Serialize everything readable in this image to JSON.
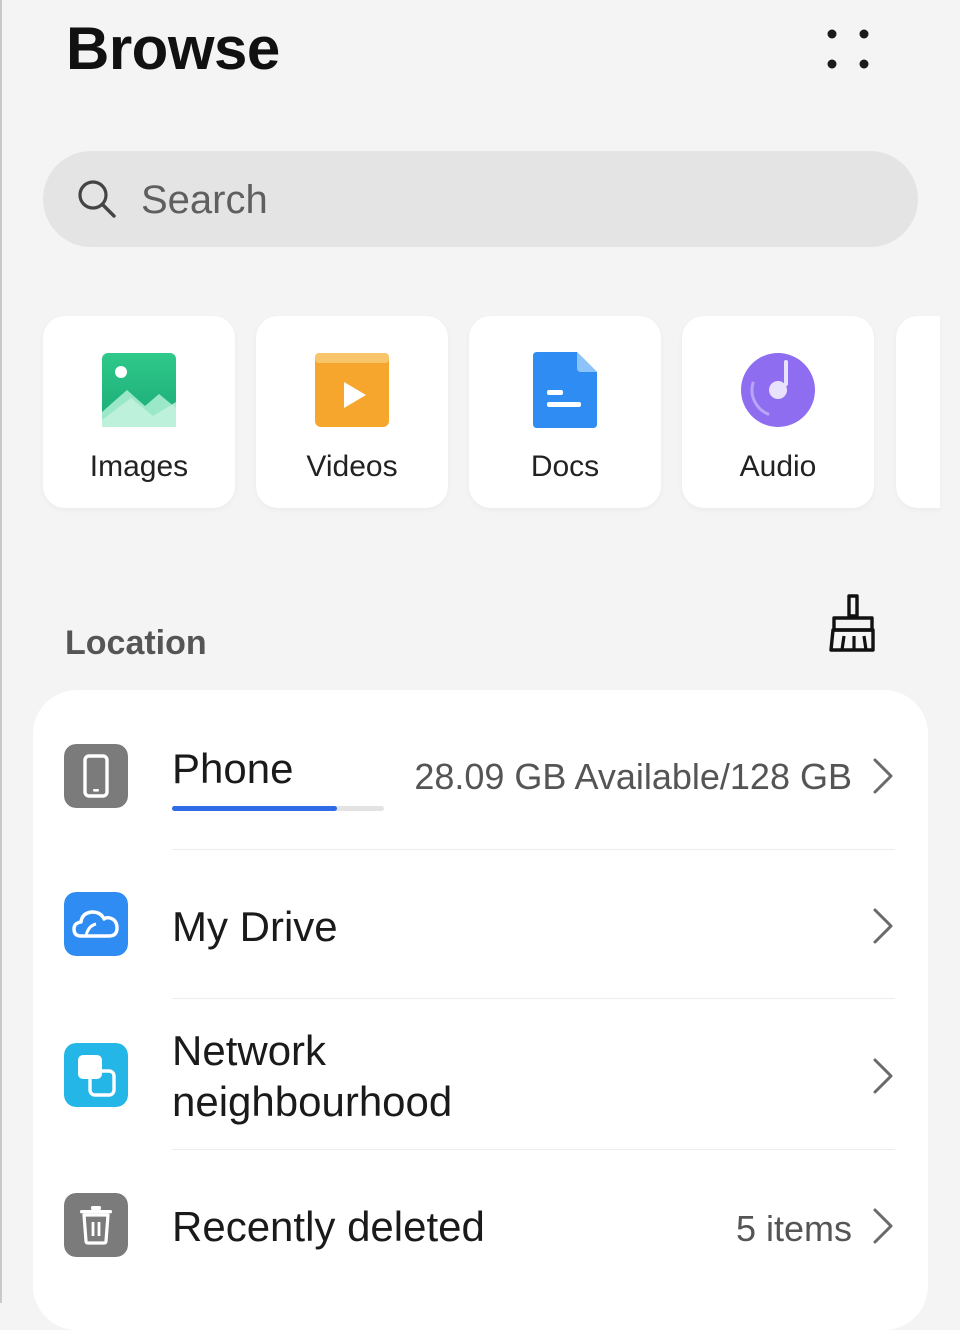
{
  "header": {
    "title": "Browse"
  },
  "search": {
    "placeholder": "Search"
  },
  "categories": [
    {
      "label": "Images",
      "icon": "image-icon"
    },
    {
      "label": "Videos",
      "icon": "video-icon"
    },
    {
      "label": "Docs",
      "icon": "document-icon"
    },
    {
      "label": "Audio",
      "icon": "audio-icon"
    }
  ],
  "location": {
    "title": "Location",
    "items": [
      {
        "label": "Phone",
        "value": "28.09 GB Available/128 GB",
        "icon": "phone-icon",
        "storage_used_fraction": 0.78
      },
      {
        "label": "My Drive",
        "value": "",
        "icon": "cloud-icon"
      },
      {
        "label_line1": "Network",
        "label_line2": "neighbourhood",
        "value": "",
        "icon": "network-icon"
      },
      {
        "label": "Recently deleted",
        "value": "5 items",
        "icon": "trash-icon"
      }
    ]
  },
  "colors": {
    "accent": "#2f6be6",
    "images": "#2bbf84",
    "videos": "#f6a62c",
    "docs": "#2f8cf3",
    "audio": "#8e6df0",
    "drive": "#2f8cf3",
    "network": "#24b6e6",
    "gray_icon": "#7b7b7b"
  }
}
